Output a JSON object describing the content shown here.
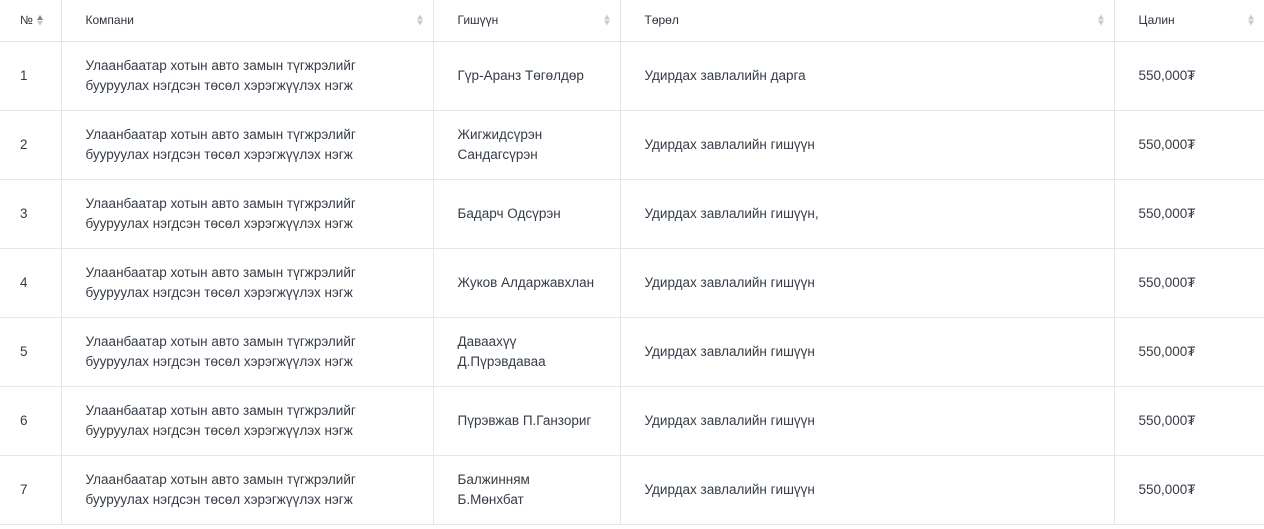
{
  "table": {
    "columns": [
      {
        "key": "no",
        "label": "№"
      },
      {
        "key": "company",
        "label": "Компани"
      },
      {
        "key": "member",
        "label": "Гишүүн"
      },
      {
        "key": "type",
        "label": "Төрөл"
      },
      {
        "key": "salary",
        "label": "Цалин"
      }
    ],
    "rows": [
      {
        "no": "1",
        "company": "Улаанбаатар хотын авто замын түгжрэлийг бууруулах нэгдсэн төсөл хэрэгжүүлэх нэгж",
        "member": "Гүр-Аранз Төгөлдөр",
        "type": "Удирдах завлалийн дарга",
        "salary": "550,000₮"
      },
      {
        "no": "2",
        "company": "Улаанбаатар хотын авто замын түгжрэлийг бууруулах нэгдсэн төсөл хэрэгжүүлэх нэгж",
        "member": "Жигжидсүрэн Сандагсүрэн",
        "type": "Удирдах завлалийн гишүүн",
        "salary": "550,000₮"
      },
      {
        "no": "3",
        "company": "Улаанбаатар хотын авто замын түгжрэлийг бууруулах нэгдсэн төсөл хэрэгжүүлэх нэгж",
        "member": "Бадарч Одсүрэн",
        "type": "Удирдах завлалийн гишүүн,",
        "salary": "550,000₮"
      },
      {
        "no": "4",
        "company": "Улаанбаатар хотын авто замын түгжрэлийг бууруулах нэгдсэн төсөл хэрэгжүүлэх нэгж",
        "member": "Жуков Алдаржавхлан",
        "type": "Удирдах завлалийн гишүүн",
        "salary": "550,000₮"
      },
      {
        "no": "5",
        "company": "Улаанбаатар хотын авто замын түгжрэлийг бууруулах нэгдсэн төсөл хэрэгжүүлэх нэгж",
        "member": "Даваахүү Д.Пүрэвдаваа",
        "type": "Удирдах завлалийн гишүүн",
        "salary": "550,000₮"
      },
      {
        "no": "6",
        "company": "Улаанбаатар хотын авто замын түгжрэлийг бууруулах нэгдсэн төсөл хэрэгжүүлэх нэгж",
        "member": "Пүрэвжав П.Ганзориг",
        "type": "Удирдах завлалийн гишүүн",
        "salary": "550,000₮"
      },
      {
        "no": "7",
        "company": "Улаанбаатар хотын авто замын түгжрэлийг бууруулах нэгдсэн төсөл хэрэгжүүлэх нэгж",
        "member": "Балжинням Б.Мөнхбат",
        "type": "Удирдах завлалийн гишүүн",
        "salary": "550,000₮"
      }
    ]
  },
  "icons": {
    "sort": "sort-icon"
  },
  "colors": {
    "border": "#e3e6ea",
    "text": "#353c47",
    "sort_active": "#7d8591",
    "sort_inactive": "#c7ccd3"
  }
}
